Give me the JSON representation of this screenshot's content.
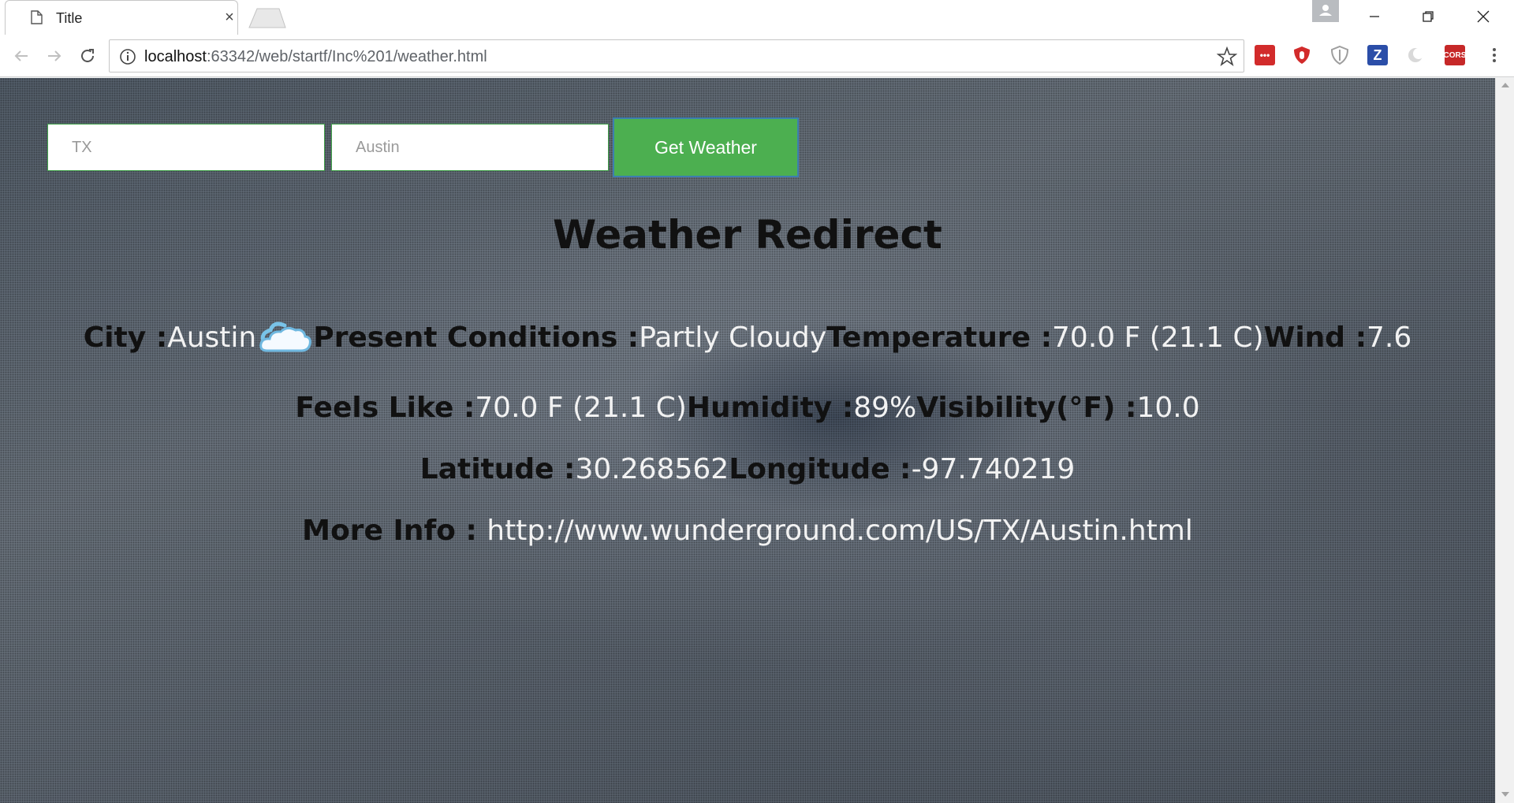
{
  "browser": {
    "tab_title": "Title",
    "tab_close_glyph": "×",
    "url_host": "localhost",
    "url_rest": ":63342/web/startf/Inc%201/weather.html",
    "icons": [
      "page-icon",
      "close-icon",
      "back-arrow-icon",
      "forward-arrow-icon",
      "reload-icon",
      "info-icon",
      "star-icon",
      "menu-icon",
      "profile-icon",
      "minimize-icon",
      "restore-icon",
      "window-close-icon"
    ],
    "extensions": [
      {
        "name": "lastpass-extension-icon",
        "label": "•••",
        "color": "#d22b2b"
      },
      {
        "name": "ublock-extension-icon",
        "label": "",
        "color": "#d22b2b"
      },
      {
        "name": "shield-extension-icon",
        "label": "",
        "color": "#9e9e9e"
      },
      {
        "name": "zotero-extension-icon",
        "label": "Z",
        "color": "#2b4ea8"
      },
      {
        "name": "moon-extension-icon",
        "label": "",
        "color": "#bdbdbd"
      },
      {
        "name": "cors-extension-icon",
        "label": "CORS",
        "color": "#c62828"
      }
    ]
  },
  "form": {
    "state_value": "",
    "state_placeholder": "TX",
    "city_value": "",
    "city_placeholder": "Austin",
    "button_label": "Get Weather",
    "accent_color": "#4caf50"
  },
  "page": {
    "heading": "Weather Redirect",
    "row1": {
      "city_label": "City  :",
      "city_value": "Austin",
      "conditions_label": "Present Conditions  :",
      "conditions_value": "Partly Cloudy",
      "temp_label": "Temperature  :",
      "temp_value": "70.0 F (21.1 C)",
      "wind_label": "Wind  :",
      "wind_value": "7.6",
      "weather_icon": "partly-cloudy-icon"
    },
    "row2": {
      "feels_label": "Feels Like  :",
      "feels_value": "70.0 F (21.1 C)",
      "humidity_label": "Humidity  :",
      "humidity_value": "89%",
      "visibility_label": "Visibility(°F)  :",
      "visibility_value": "10.0"
    },
    "row3": {
      "lat_label": "Latitude  :",
      "lat_value": "30.268562",
      "lon_label": "Longitude  :",
      "lon_value": "-97.740219"
    },
    "row4": {
      "more_label": "More Info  : ",
      "more_link": "http://www.wunderground.com/US/TX/Austin.html"
    }
  }
}
